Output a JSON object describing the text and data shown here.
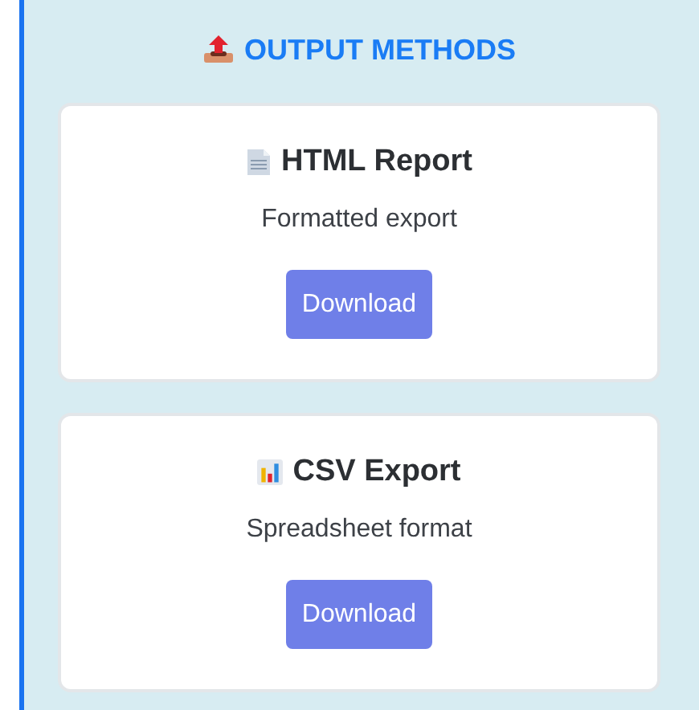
{
  "section": {
    "title": "OUTPUT METHODS"
  },
  "methods": [
    {
      "kind": "document",
      "title": "HTML Report",
      "description": "Formatted export",
      "button": "Download"
    },
    {
      "kind": "chart",
      "title": "CSV Export",
      "description": "Spreadsheet format",
      "button": "Download"
    }
  ]
}
